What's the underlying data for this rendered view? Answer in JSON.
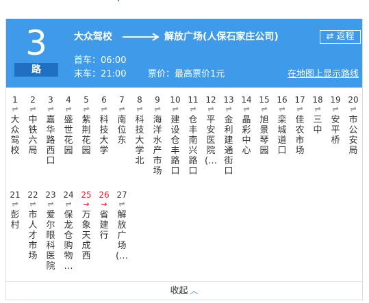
{
  "route": {
    "number": "3",
    "unit": "路",
    "from": "大众驾校",
    "to": "解放广场(人保石家庄公司)"
  },
  "schedule": {
    "first": "首车：06:00",
    "last": "末车：21:00",
    "fare": "票价：最高票价1元"
  },
  "actions": {
    "return_label": "⇄ 返程",
    "map_link": "在地图上显示路线",
    "collapse_label": "收起"
  },
  "colors": {
    "header_bg": "#3f9bea",
    "unit_bg": "#1f6fc2",
    "highlight": "#e6262c"
  },
  "stops": [
    {
      "num": "1",
      "name": "大众驾校",
      "dir": "⇌"
    },
    {
      "num": "2",
      "name": "中铁六局",
      "dir": "⇌"
    },
    {
      "num": "3",
      "name": "嘉华路西口",
      "dir": "⇌"
    },
    {
      "num": "4",
      "name": "盛世花园",
      "dir": "⇌"
    },
    {
      "num": "5",
      "name": "紫荆花园",
      "dir": "⇌"
    },
    {
      "num": "6",
      "name": "科技大学",
      "dir": "⇌"
    },
    {
      "num": "7",
      "name": "南位东",
      "dir": "⇌"
    },
    {
      "num": "8",
      "name": "科技大学北",
      "dir": "⇌"
    },
    {
      "num": "9",
      "name": "海洋水产市场",
      "dir": "⇌"
    },
    {
      "num": "10",
      "name": "建设仓丰路口",
      "dir": "⇌"
    },
    {
      "num": "11",
      "name": "仓丰南兴路口",
      "dir": "⇌"
    },
    {
      "num": "12",
      "name": "平安医院(…",
      "dir": "⇌"
    },
    {
      "num": "13",
      "name": "金利建通街口",
      "dir": "⇌"
    },
    {
      "num": "14",
      "name": "晶彩中心",
      "dir": "⇌"
    },
    {
      "num": "15",
      "name": "旭景琴园",
      "dir": "⇌"
    },
    {
      "num": "16",
      "name": "栾城道口",
      "dir": "⇌"
    },
    {
      "num": "17",
      "name": "佳农市场",
      "dir": "⇌"
    },
    {
      "num": "18",
      "name": "三中",
      "dir": "⇌"
    },
    {
      "num": "19",
      "name": "安平桥",
      "dir": "⇌"
    },
    {
      "num": "20",
      "name": "市公安局",
      "dir": "⇌"
    },
    {
      "num": "21",
      "name": "彭村",
      "dir": "⇌"
    },
    {
      "num": "22",
      "name": "市人才市场",
      "dir": "⇌"
    },
    {
      "num": "23",
      "name": "爱尔眼科医院",
      "dir": "⇌"
    },
    {
      "num": "24",
      "name": "保龙仓购物…",
      "dir": "⇌"
    },
    {
      "num": "25",
      "name": "万象天成西",
      "dir": "→",
      "highlight": true
    },
    {
      "num": "26",
      "name": "省建行",
      "dir": "→",
      "highlight": true
    },
    {
      "num": "27",
      "name": "解放广场(…",
      "dir": "⇌"
    }
  ]
}
